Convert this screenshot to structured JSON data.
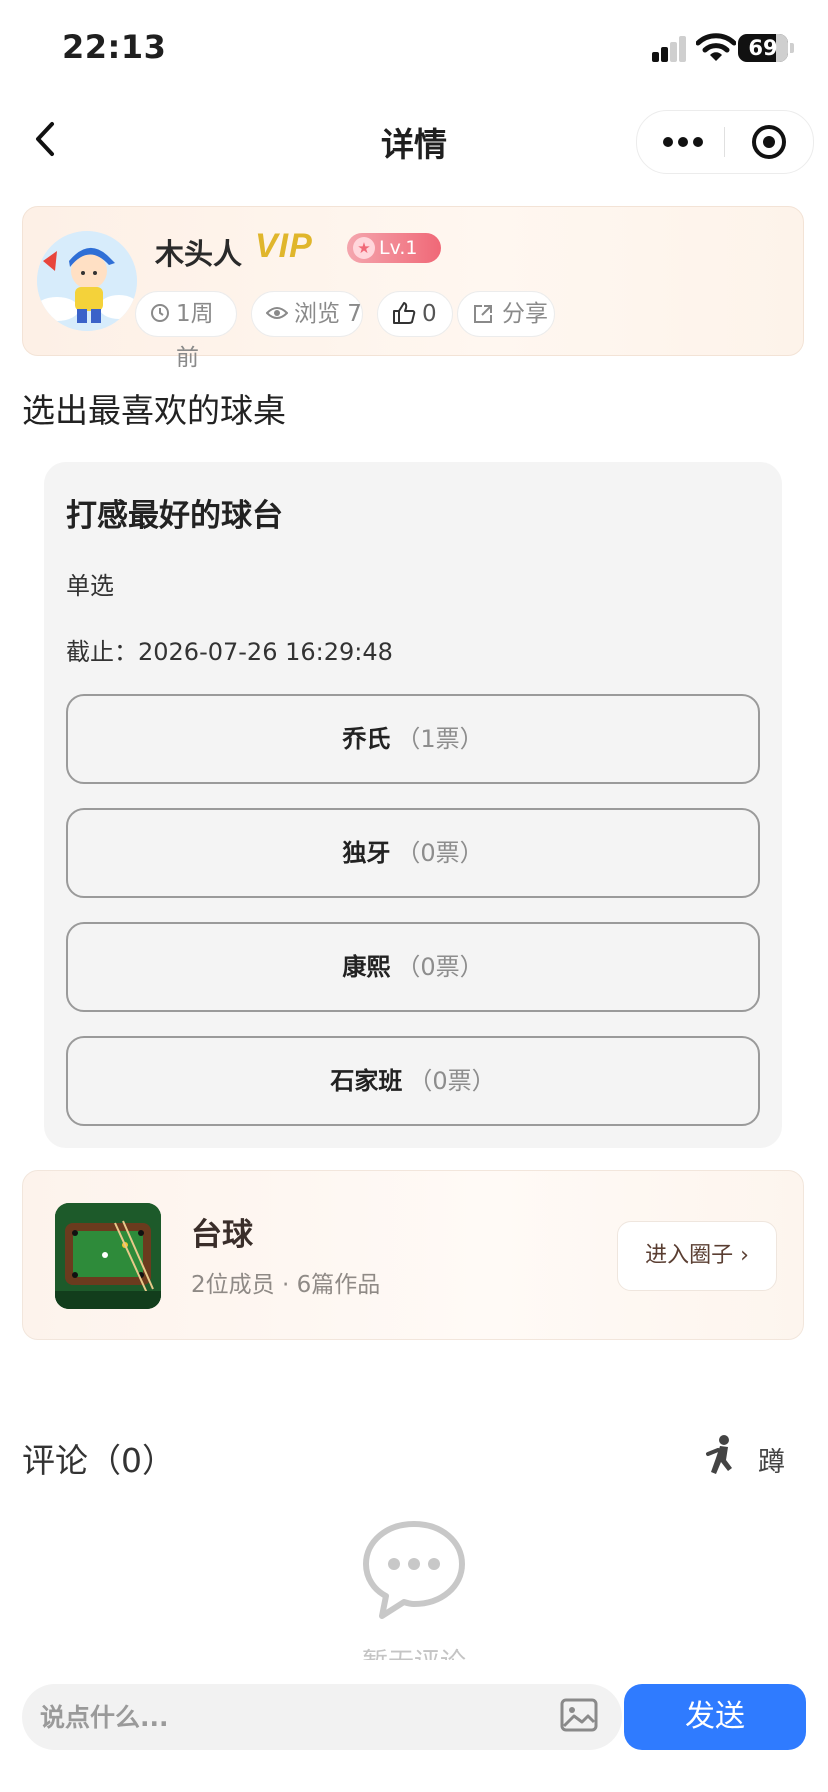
{
  "status_bar": {
    "time": "22:13",
    "battery": "69"
  },
  "nav": {
    "title": "详情"
  },
  "author": {
    "name": "木头人",
    "vip_label": "VIP",
    "level": "Lv.1",
    "posted": "1周前",
    "views_label": "浏览 7",
    "likes": "0",
    "share_label": "分享"
  },
  "post": {
    "title": "选出最喜欢的球桌"
  },
  "poll": {
    "title": "打感最好的球台",
    "type": "单选",
    "deadline": "截止：2026-07-26 16:29:48",
    "options": [
      {
        "name": "乔氏",
        "votes": "（1票）"
      },
      {
        "name": "独牙",
        "votes": "（0票）"
      },
      {
        "name": "康熙",
        "votes": "（0票）"
      },
      {
        "name": "石家班",
        "votes": "（0票）"
      }
    ]
  },
  "circle": {
    "name": "台球",
    "stats": "2位成员 · 6篇作品",
    "enter_label": "进入圈子 ›"
  },
  "comments": {
    "title": "评论（0）",
    "squat_label": "蹲",
    "empty_text": "暂无评论"
  },
  "composer": {
    "placeholder": "说点什么...",
    "send_label": "发送"
  },
  "colors": {
    "accent": "#2f7bff",
    "vip_gold": "#e0b62c",
    "level_pink": "#f06877"
  }
}
